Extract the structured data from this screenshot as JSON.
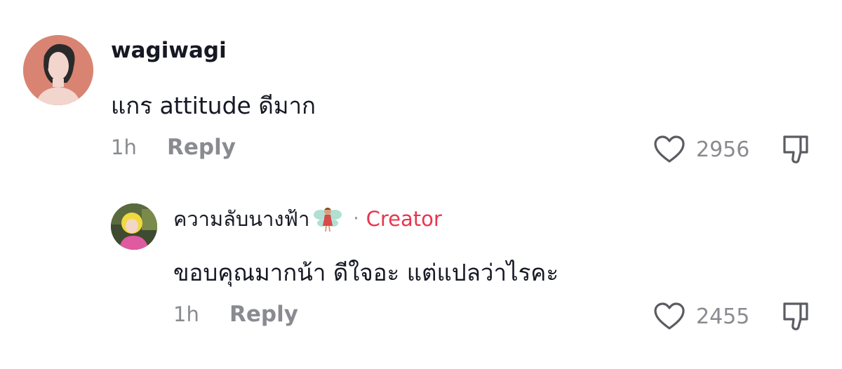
{
  "comment": {
    "username": "wagiwagi",
    "text": "แกร attitude ดีมาก",
    "time": "1h",
    "reply_label": "Reply",
    "likes": "2956",
    "avatar_icon": "avatar-illustration-icon"
  },
  "reply": {
    "username": "ความลับนางฟ้า",
    "emoji_icon": "fairy-emoji-icon",
    "separator": "·",
    "badge": "Creator",
    "text": "ขอบคุณมากน้า ดีใจอะ แต่แปลว่าไรคะ",
    "time": "1h",
    "reply_label": "Reply",
    "likes": "2455",
    "avatar_icon": "avatar-photo-icon"
  },
  "colors": {
    "text_primary": "#161823",
    "text_secondary": "#8a8b91",
    "creator_accent": "#e8364f",
    "background": "#ffffff"
  }
}
